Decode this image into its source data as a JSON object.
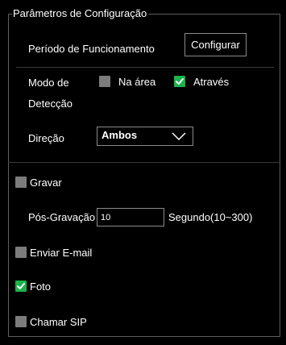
{
  "group_title": "Parâmetros de Configuração",
  "period": {
    "label": "Período de Funcionamento",
    "button": "Configurar"
  },
  "detection": {
    "label_line1": "Modo de",
    "label_line2": "Detecção",
    "options": [
      {
        "label": "Na área",
        "checked": false
      },
      {
        "label": "Através",
        "checked": true
      }
    ]
  },
  "direction": {
    "label": "Direção",
    "selected": "Ambos"
  },
  "record": {
    "label": "Gravar",
    "checked": false
  },
  "post_record": {
    "label": "Pós-Gravação",
    "value": "10",
    "unit": "Segundo(10~300)"
  },
  "email": {
    "label": "Enviar E-mail",
    "checked": false
  },
  "photo": {
    "label": "Foto",
    "checked": true
  },
  "sip": {
    "label": "Chamar SIP",
    "checked": false
  },
  "colors": {
    "background": "#000000",
    "checked": "#1bb34a",
    "unchecked": "#7c7c7c",
    "border": "#8a8a8a"
  }
}
